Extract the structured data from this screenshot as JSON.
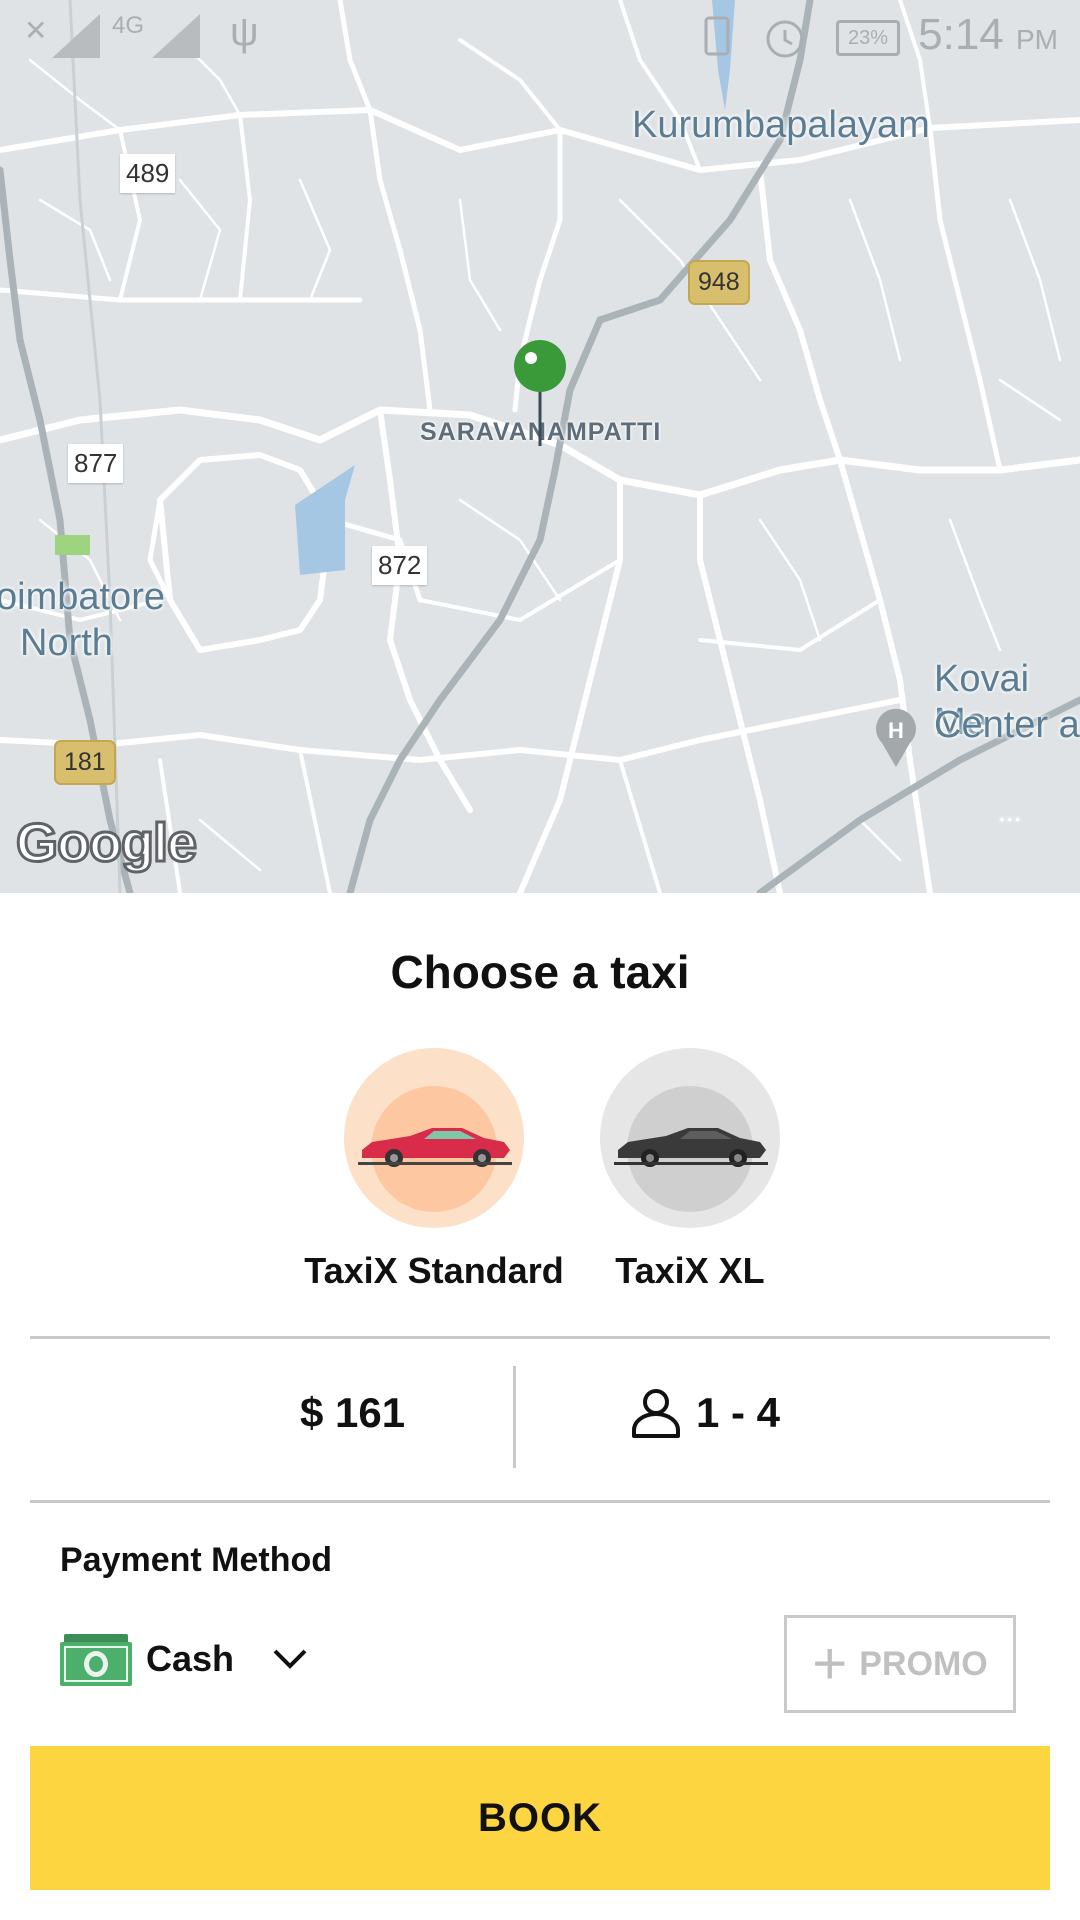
{
  "status_bar": {
    "network": "4G",
    "battery": "23%",
    "time": "5:14",
    "ampm": "PM"
  },
  "map": {
    "places": {
      "kurumbapalayam": "Kurumbapalayam",
      "saravanampatti": "SARAVANAMPATTI",
      "coimbatore_north_1": "oimbatore",
      "coimbatore_north_2": "North",
      "kovai_1": "Kovai Me",
      "kovai_2": "Center a"
    },
    "road_labels": {
      "r489": "489",
      "r877": "877",
      "r872": "872"
    },
    "highway_shields": {
      "h948": "948",
      "h181": "181"
    },
    "poi_letter": "H",
    "attribution": "Google",
    "more": "..."
  },
  "sheet": {
    "title": "Choose a taxi",
    "taxis": [
      {
        "name": "TaxiX Standard",
        "selected": true,
        "circle_color": "#fde0c8",
        "sun_color": "#fdc7a2",
        "car_color": "#d82c4a"
      },
      {
        "name": "TaxiX XL",
        "selected": false,
        "circle_color": "#e6e6e6",
        "sun_color": "#cfcfcf",
        "car_color": "#3a3a3a"
      }
    ],
    "price": "$ 161",
    "seats": "1 - 4",
    "payment_method_title": "Payment Method",
    "payment_method": "Cash",
    "promo_label": "PROMO",
    "book_label": "BOOK",
    "accent_color": "#fdd541"
  }
}
